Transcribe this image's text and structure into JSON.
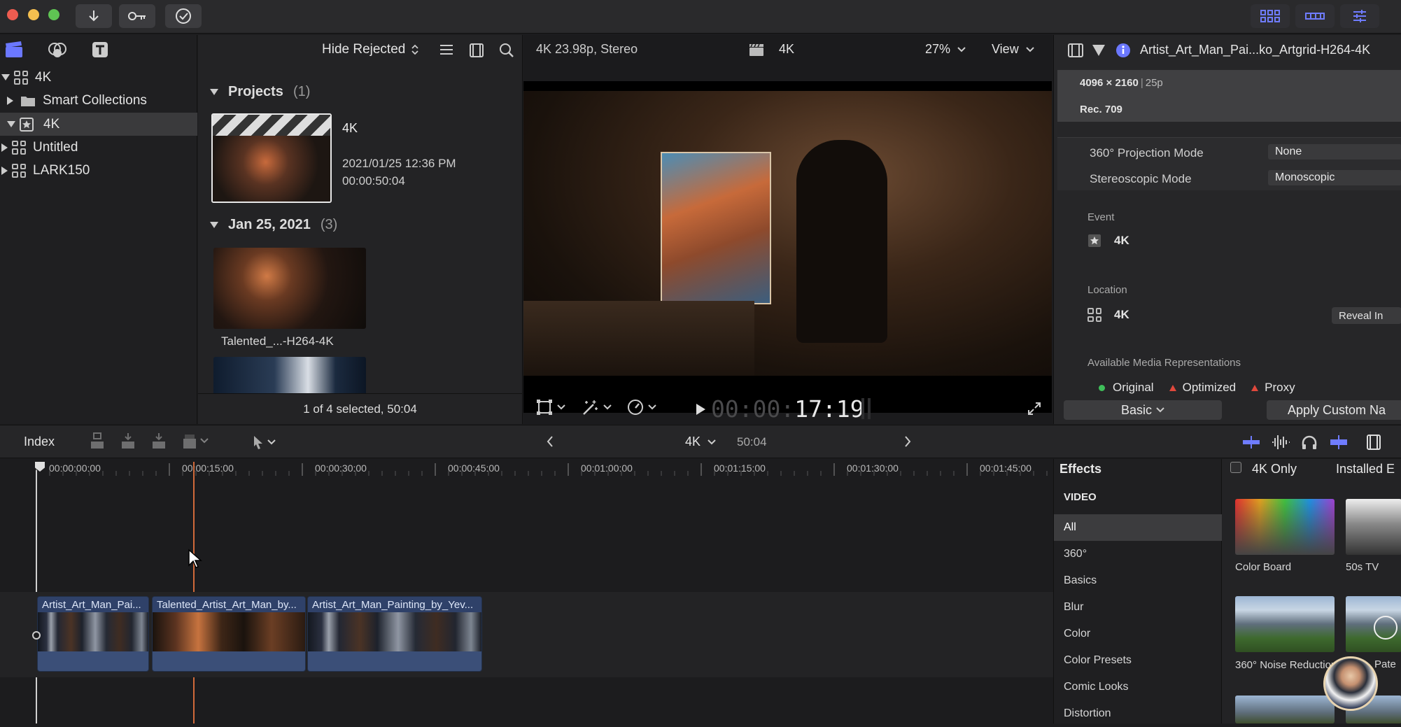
{
  "toolbar": {
    "icons": [
      "import-icon",
      "keywords-icon",
      "background-tasks-icon",
      "browser-layout-icon",
      "timeline-layout-icon",
      "inspector-layout-icon"
    ]
  },
  "library": {
    "items": [
      {
        "label": "4K",
        "icon": "library-grid-icon"
      },
      {
        "label": "Smart Collections",
        "icon": "folder-icon"
      },
      {
        "label": "4K",
        "icon": "event-star-icon"
      },
      {
        "label": "Untitled",
        "icon": "library-grid-icon"
      },
      {
        "label": "LARK150",
        "icon": "library-grid-icon"
      }
    ]
  },
  "browser": {
    "filter": "Hide Rejected",
    "projects_header": "Projects",
    "projects_count": "(1)",
    "project": {
      "name": "4K",
      "date": "2021/01/25 12:36 PM",
      "duration": "00:00:50:04"
    },
    "date_header": "Jan 25, 2021",
    "date_count": "(3)",
    "clip_name": "Talented_...-H264-4K",
    "status": "1 of 4 selected, 50:04"
  },
  "viewer": {
    "format": "4K 23.98p, Stereo",
    "project_name": "4K",
    "zoom": "27%",
    "view_label": "View",
    "timecode_dim": "00:00:",
    "timecode": "17:19"
  },
  "inspector": {
    "title": "Artist_Art_Man_Pai...ko_Artgrid-H264-4K",
    "resolution": "4096 × 2160",
    "framerate": "25p",
    "colorspace": "Rec. 709",
    "projection_label": "360° Projection Mode",
    "projection_value": "None",
    "stereo_label": "Stereoscopic Mode",
    "stereo_value": "Monoscopic",
    "event_label": "Event",
    "event_value": "4K",
    "location_label": "Location",
    "location_value": "4K",
    "reveal_label": "Reveal In",
    "media_label": "Available Media Representations",
    "media": [
      {
        "label": "Original",
        "color": "#3fbf5a"
      },
      {
        "label": "Optimized",
        "color": "#e0483c"
      },
      {
        "label": "Proxy",
        "color": "#e0483c"
      }
    ],
    "basic_label": "Basic",
    "apply_label": "Apply Custom Na"
  },
  "timeline_bar": {
    "index_label": "Index",
    "project_name": "4K",
    "duration": "50:04"
  },
  "ruler": {
    "labels": [
      "00:00:00:00",
      "00:00:15:00",
      "00:00:30:00",
      "00:00:45:00",
      "00:01:00:00",
      "00:01:15:00",
      "00:01:30:00",
      "00:01:45:00"
    ]
  },
  "clips": [
    {
      "label": "Artist_Art_Man_Pai..."
    },
    {
      "label": "Talented_Artist_Art_Man_by..."
    },
    {
      "label": "Artist_Art_Man_Painting_by_Yev..."
    }
  ],
  "effects": {
    "header": "Effects",
    "filter_label": "4K Only",
    "installed_label": "Installed E",
    "section": "VIDEO",
    "categories": [
      "All",
      "360°",
      "Basics",
      "Blur",
      "Color",
      "Color Presets",
      "Comic Looks",
      "Distortion"
    ],
    "selected": "All",
    "items": [
      {
        "label": "Color Board"
      },
      {
        "label": "50s TV"
      },
      {
        "label": "360° Noise Reduction"
      },
      {
        "label": "Pate"
      }
    ]
  }
}
